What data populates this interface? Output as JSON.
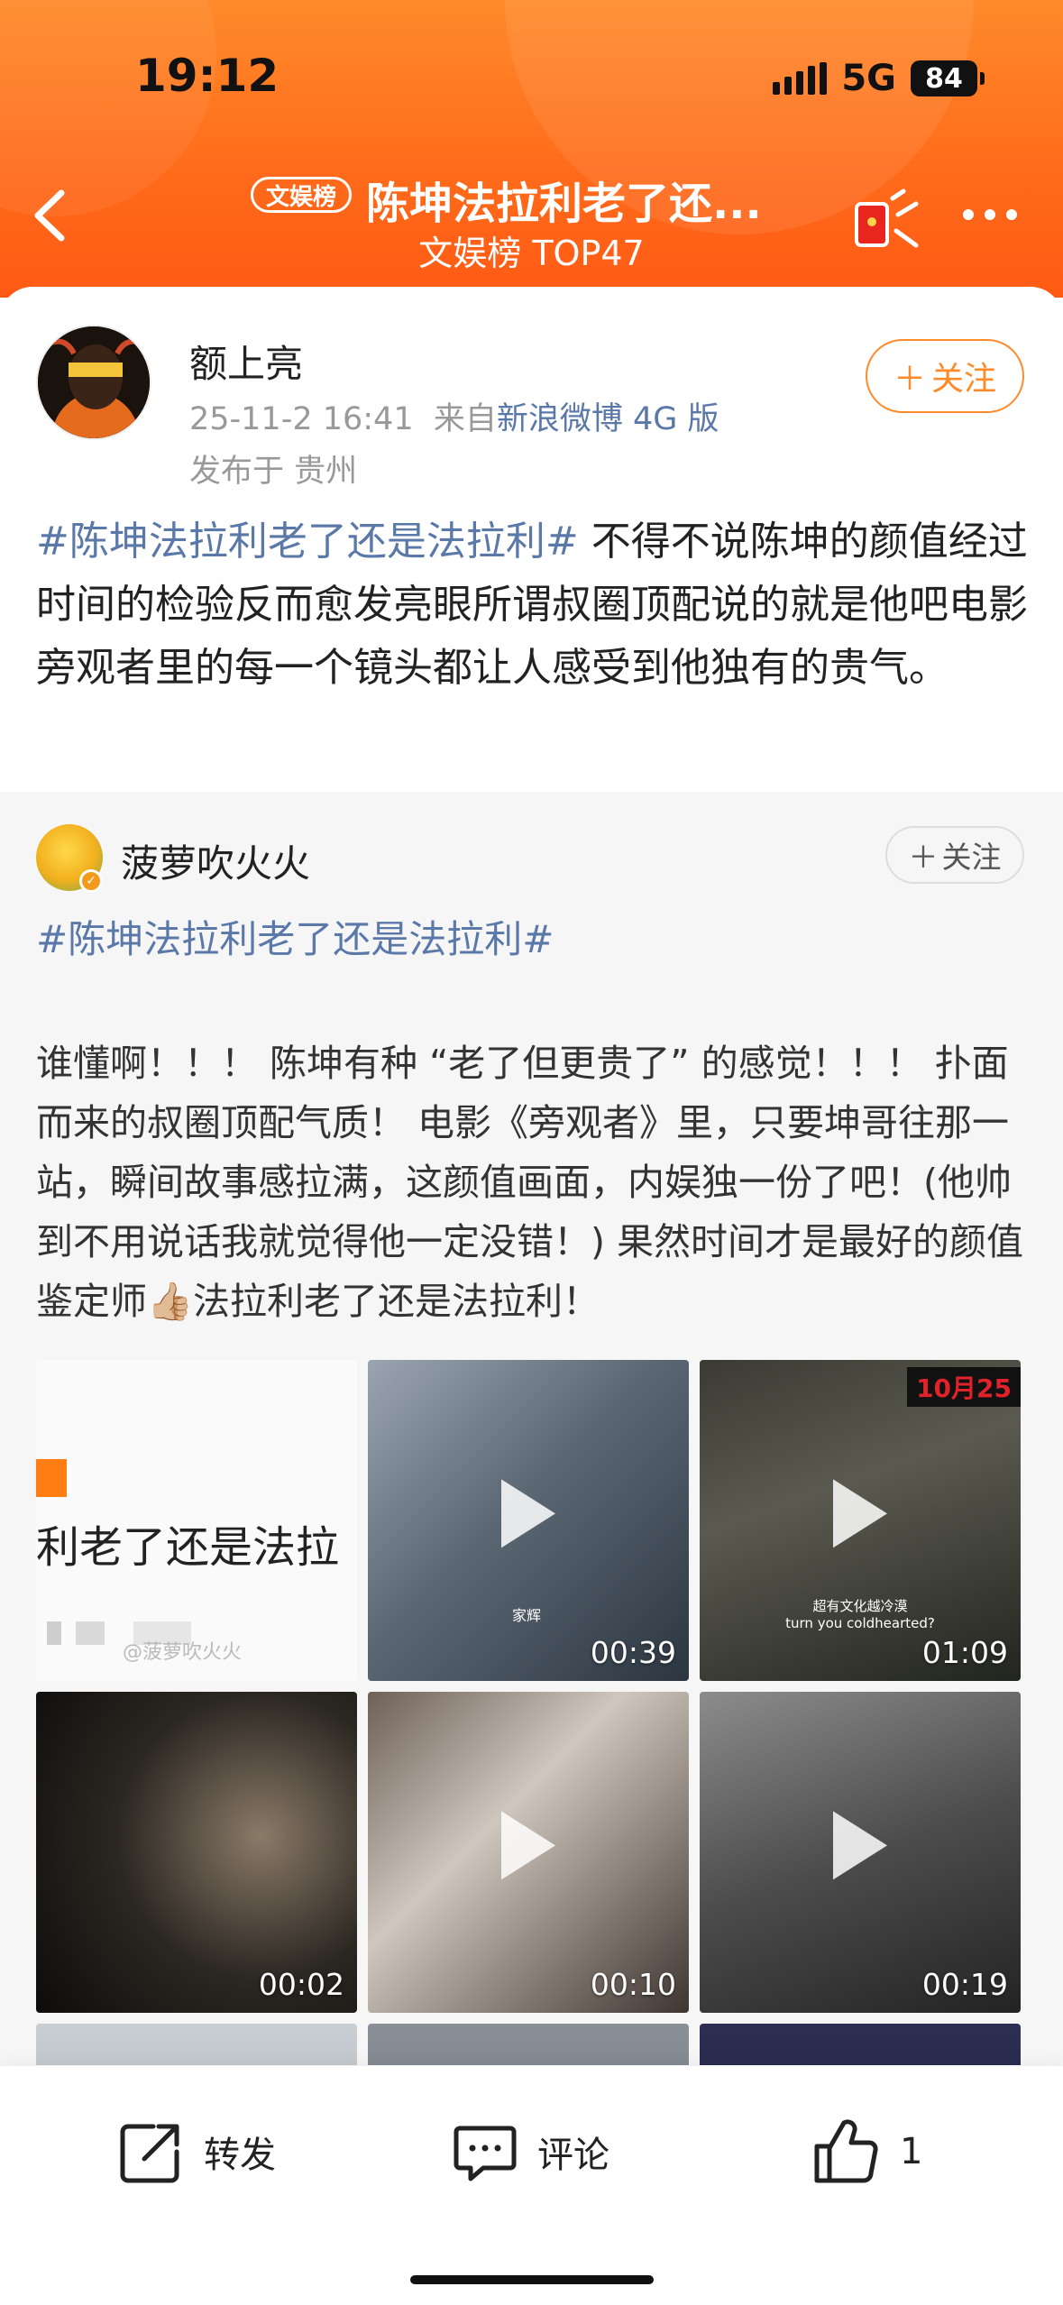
{
  "status_bar": {
    "time": "19:12",
    "network": "5G",
    "battery": "84"
  },
  "header": {
    "badge": "文娱榜",
    "title": "陈坤法拉利老了还...",
    "subtitle": "文娱榜 TOP47"
  },
  "post": {
    "author": "额上亮",
    "time": "25-11-2 16:41",
    "from_prefix": "来自",
    "source": "新浪微博 4G 版",
    "location": "发布于 贵州",
    "follow_label": "关注",
    "hashtag": "#陈坤法拉利老了还是法拉利#",
    "text": " 不得不说陈坤的颜值经过时间的检验反而愈发亮眼所谓叔圈顶配说的就是他吧电影旁观者里的每一个镜头都让人感受到他独有的贵气。"
  },
  "repost": {
    "author": "菠萝吹火火",
    "follow_label": "关注",
    "hashtag": "#陈坤法拉利老了还是法拉利#",
    "text": "谁懂啊！！！ 陈坤有种 “老了但更贵了” 的感觉！！！ 扑面而来的叔圈顶配气质！ 电影《旁观者》里，只要坤哥往那一站，瞬间故事感拉满，这颜值画面，内娱独一份了吧！(他帅到不用说话我就觉得他一定没错！) 果然时间才是最好的颜值鉴定师👍🏼法拉利老了还是法拉利！",
    "media": [
      {
        "overlay_text": "利老了还是法拉",
        "watermark": "@菠萝吹火火"
      },
      {
        "duration": "00:39",
        "caption": "家辉"
      },
      {
        "duration": "01:09",
        "subtitle_cn": "超有文化越冷漠",
        "subtitle_en": "turn you coldhearted?",
        "date_tag": "10月25"
      },
      {
        "duration": "00:02"
      },
      {
        "duration": "00:10"
      },
      {
        "duration": "00:19"
      }
    ]
  },
  "actions": {
    "share": "转发",
    "comment": "评论",
    "like_count": "1"
  },
  "colors": {
    "accent": "#ff8a2a",
    "link": "#5a78a8"
  }
}
